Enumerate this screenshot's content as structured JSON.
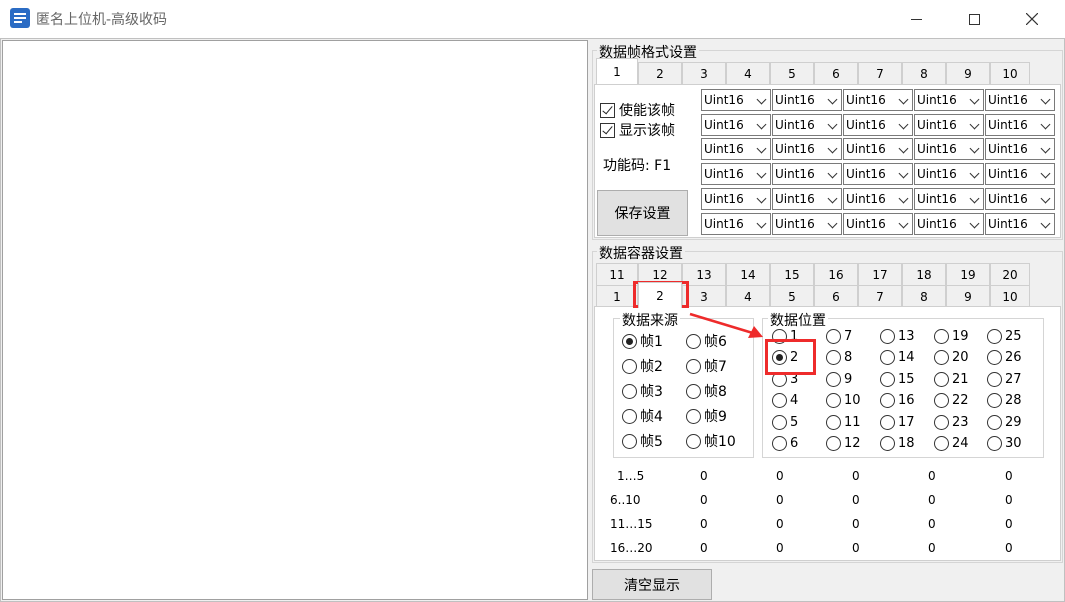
{
  "window": {
    "title": "匿名上位机-高级收码"
  },
  "frame_group": {
    "title": "数据帧格式设置",
    "tabs": [
      "1",
      "2",
      "3",
      "4",
      "5",
      "6",
      "7",
      "8",
      "9",
      "10"
    ],
    "selected_tab": "1",
    "enable_label": "使能该帧",
    "show_label": "显示该帧",
    "func_code": "功能码: F1",
    "save_label": "保存设置",
    "combo_value": "Uint16"
  },
  "container_group": {
    "title": "数据容器设置",
    "tabs_row1": [
      "11",
      "12",
      "13",
      "14",
      "15",
      "16",
      "17",
      "18",
      "19",
      "20"
    ],
    "tabs_row2": [
      "1",
      "2",
      "3",
      "4",
      "5",
      "6",
      "7",
      "8",
      "9",
      "10"
    ],
    "selected_tab": "2",
    "source": {
      "title": "数据来源",
      "options": [
        "帧1",
        "帧2",
        "帧3",
        "帧4",
        "帧5",
        "帧6",
        "帧7",
        "帧8",
        "帧9",
        "帧10"
      ],
      "selected": "帧1"
    },
    "position": {
      "title": "数据位置",
      "options": [
        "1",
        "2",
        "3",
        "4",
        "5",
        "6",
        "7",
        "8",
        "9",
        "10",
        "11",
        "12",
        "13",
        "14",
        "15",
        "16",
        "17",
        "18",
        "19",
        "20",
        "21",
        "22",
        "23",
        "24",
        "25",
        "26",
        "27",
        "28",
        "29",
        "30"
      ],
      "selected": "2"
    },
    "table": {
      "row_labels": [
        "1…5",
        "6..10",
        "11…15",
        "16…20"
      ],
      "rows": [
        [
          "0",
          "0",
          "0",
          "0",
          "0"
        ],
        [
          "0",
          "0",
          "0",
          "0",
          "0"
        ],
        [
          "0",
          "0",
          "0",
          "0",
          "0"
        ],
        [
          "0",
          "0",
          "0",
          "0",
          "0"
        ]
      ]
    }
  },
  "clear_label": "清空显示",
  "colors": {
    "highlight": "#ee2b2b",
    "icon": "#2b6cc4"
  }
}
